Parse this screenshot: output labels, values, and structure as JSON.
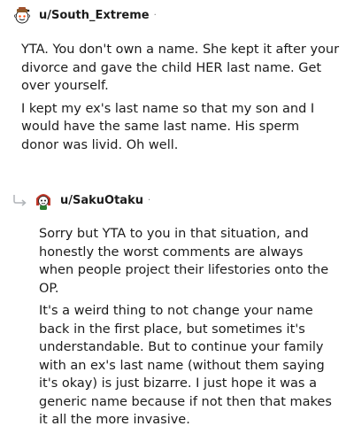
{
  "comments": [
    {
      "username": "u/South_Extreme",
      "separator": "·",
      "avatar_icon": "snoo-avatar-icon",
      "paragraphs": [
        "YTA. You don't own a name. She kept it after your divorce and gave the child HER last name. Get over yourself.",
        "I kept my ex's last name so that my son and I would have the same last name. His sperm donor was livid. Oh well."
      ]
    },
    {
      "username": "u/SakuOtaku",
      "separator": "·",
      "avatar_icon": "snoo-avatar-red-hair-icon",
      "reply_icon": "reply-arrow-icon",
      "paragraphs": [
        "Sorry but YTA to you in that situation, and honestly the worst comments are always when people project their lifestories onto the OP.",
        "It's a weird thing to not change your name back in the first place, but sometimes it's understandable. But to continue your family with an ex's last name (without them saying it's okay) is just bizarre. I just hope it was a generic name because if not then that makes it all the more invasive."
      ]
    }
  ]
}
